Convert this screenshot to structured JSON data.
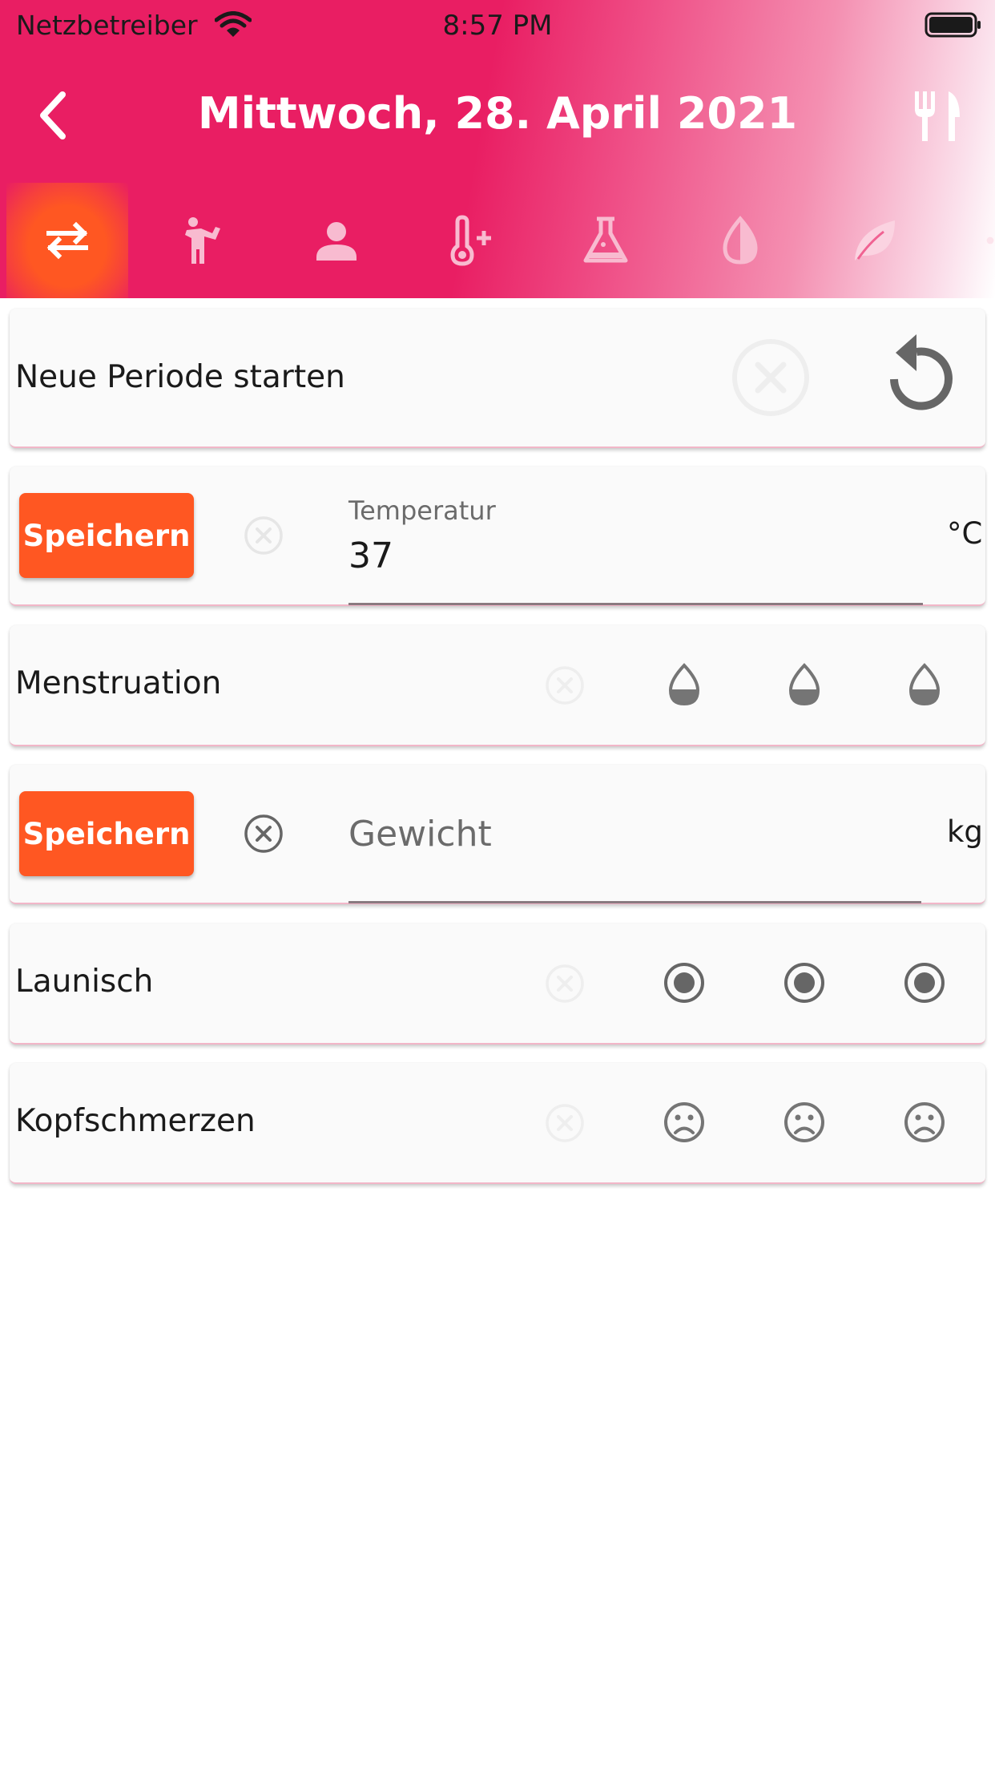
{
  "status_bar": {
    "carrier": "Netzbetreiber",
    "time": "8:57 PM"
  },
  "header": {
    "title": "Mittwoch, 28. April 2021",
    "back_icon": "chevron-left-icon",
    "action_icon": "restaurant-icon"
  },
  "tabs": [
    {
      "icon": "swap-icon",
      "active": true
    },
    {
      "icon": "activity-person-icon",
      "active": false
    },
    {
      "icon": "person-icon",
      "active": false
    },
    {
      "icon": "thermometer-plus-icon",
      "active": false
    },
    {
      "icon": "flask-icon",
      "active": false
    },
    {
      "icon": "contrast-drop-icon",
      "active": false
    },
    {
      "icon": "leaf-icon",
      "active": false
    },
    {
      "icon": "circle-icon",
      "active": false
    }
  ],
  "cards": {
    "period": {
      "label": "Neue Periode starten"
    },
    "temperature": {
      "save_label": "Speichern",
      "field_label": "Temperatur",
      "value": "37",
      "unit": "°C"
    },
    "menstruation": {
      "label": "Menstruation"
    },
    "weight": {
      "save_label": "Speichern",
      "placeholder": "Gewicht",
      "unit": "kg"
    },
    "mood": {
      "label": "Launisch"
    },
    "headache": {
      "label": "Kopfschmerzen"
    }
  },
  "colors": {
    "primary": "#e91e63",
    "accent": "#ff5722",
    "card": "#fafafa",
    "icon_gray": "#757575"
  }
}
